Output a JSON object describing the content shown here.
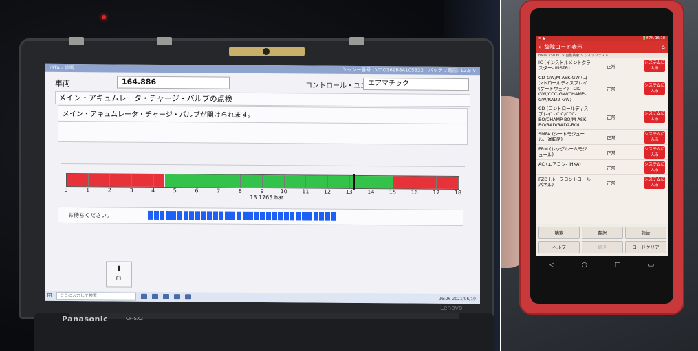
{
  "laptop": {
    "titlebar_left": "ISTA - 診断",
    "titlebar_right": "シャシー番号 | VDO169B8A105322 | バッテリ電圧: 12.8 V",
    "vehicle_label": "車両",
    "vehicle_value": "164.886",
    "control_unit_label": "コントロール・ユニット",
    "control_unit_value": "エアマチック",
    "section_title": "メイン・アキュムレータ・チャージ・バルブの点検",
    "message": "メイン・アキュムレータ・チャージ・バルブが開けられます。",
    "wait_text": "お待ちください。",
    "f1_label": "F1",
    "f1_arrow": "⬆",
    "search_placeholder": "ここに入力して検索",
    "tray_text": "16:26 2021/06/19",
    "brand": "Panasonic",
    "model": "CF-SX2",
    "logo_text": "Lenovo"
  },
  "gauge": {
    "min": 0,
    "max": 18,
    "value": 13.1765,
    "value_text": "13.1765 bar",
    "ticks": [
      "0",
      "1",
      "2",
      "3",
      "4",
      "5",
      "6",
      "7",
      "8",
      "9",
      "10",
      "11",
      "12",
      "13",
      "14",
      "15",
      "16",
      "17",
      "18"
    ],
    "zones": [
      {
        "from": 0,
        "to": 4.5,
        "color": "#e8323a"
      },
      {
        "from": 4.5,
        "to": 15,
        "color": "#33c24a"
      },
      {
        "from": 15,
        "to": 18,
        "color": "#e8323a"
      }
    ],
    "progress_blocks": 32,
    "progress_color": "#1e5ff5"
  },
  "phone": {
    "status_left": "≋ ▲",
    "status_right": "🔋67% 16:18",
    "header_title": "故障コード表示",
    "breadcrumb": "BMW V50.60 > 自動検索 > クイックテスト",
    "rows": [
      {
        "name": "IC (インストルメントクラスター- INSTR)",
        "status": "正常",
        "button": "システムに入る"
      },
      {
        "name": "CD-GW/M-ASK-GW (コントロールディスプレイ(ゲートウェイ) - CIC-GW/CCC-GW/CHAMP-GW/RAD2-GW)",
        "status": "正常",
        "button": "システムに入る"
      },
      {
        "name": "CD (コントロールディスプレイ - CIC/CCC-BO/CHAMP-BO/M-ASK-BO/RAD/RAD2-BO)",
        "status": "正常",
        "button": "システムに入る"
      },
      {
        "name": "SMFA (シートモジュール、運転席)",
        "status": "正常",
        "button": "システムに入る"
      },
      {
        "name": "FRM (レッグルームモジュール)",
        "status": "正常",
        "button": "システムに入る"
      },
      {
        "name": "AC (エアコン- IHKA)",
        "status": "正常",
        "button": "システムに入る"
      },
      {
        "name": "FZD (ルーフコントロールパネル)",
        "status": "正常",
        "button": "システムに入る"
      }
    ],
    "buttons": {
      "search": "検索",
      "translate": "翻訳",
      "report": "報告",
      "help": "ヘルプ",
      "continue": "続き",
      "clear_codes": "コードクリア"
    },
    "nav": {
      "back": "◁",
      "home": "○",
      "recent": "□",
      "extra": "▭"
    },
    "brand_color": "#d8322e"
  }
}
